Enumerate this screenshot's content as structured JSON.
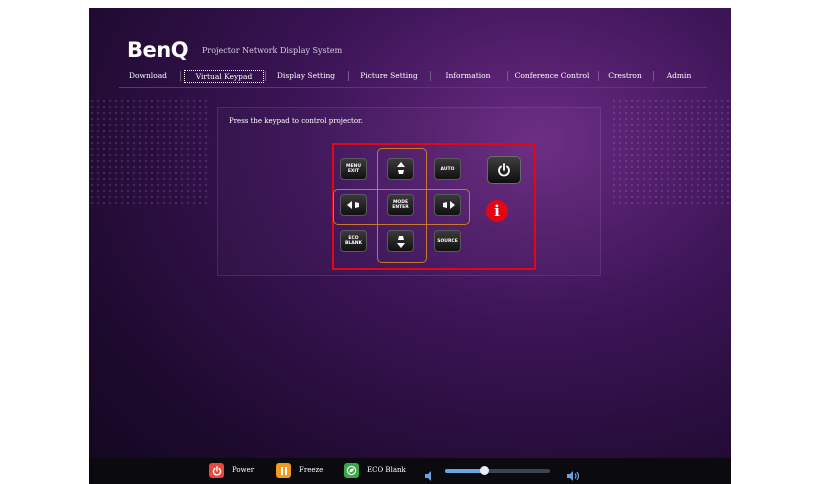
{
  "brand": {
    "logo": "BenQ",
    "title": "Projector Network Display System"
  },
  "nav": {
    "tabs": [
      {
        "label": "Download"
      },
      {
        "label": "Virtual Keypad",
        "active": true
      },
      {
        "label": "Display Setting"
      },
      {
        "label": "Picture Setting"
      },
      {
        "label": "Information"
      },
      {
        "label": "Conference Control"
      },
      {
        "label": "Crestron"
      },
      {
        "label": "Admin"
      }
    ]
  },
  "keypad": {
    "prompt": "Press the keypad to control projector.",
    "keys": {
      "menu_line1": "MENU",
      "menu_line2": "EXIT",
      "auto": "AUTO",
      "mode_line1": "MODE",
      "mode_line2": "ENTER",
      "eco_line1": "ECO",
      "eco_line2": "BLANK",
      "source": "SOURCE"
    },
    "callout": "i"
  },
  "bottom_bar": {
    "power_label": "Power",
    "freeze_label": "Freeze",
    "eco_blank_label": "ECO Blank",
    "volume_level": 0.37
  },
  "colors": {
    "accent_red": "#e30613",
    "ring_orange": "#c8792c",
    "power_icon": "#e8473c",
    "freeze_icon": "#f29a1e",
    "eco_icon": "#3aa845",
    "volume_blue": "#6aa4e0"
  }
}
